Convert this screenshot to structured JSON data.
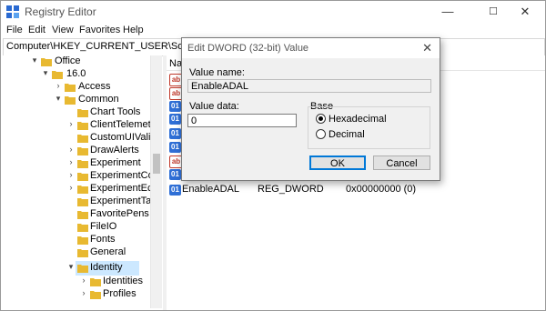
{
  "window": {
    "title": "Registry Editor",
    "minimize": "—",
    "maximize": "☐",
    "close": "✕"
  },
  "menu": [
    "File",
    "Edit",
    "View",
    "Favorites",
    "Help"
  ],
  "address": "Computer\\HKEY_CURRENT_USER\\Software\\Micro",
  "tree": [
    {
      "label": "Office",
      "chev": "▾"
    },
    {
      "label": "16.0",
      "chev": "▾"
    },
    {
      "label": "Access",
      "chev": "›"
    },
    {
      "label": "Common",
      "chev": "▾"
    },
    {
      "label": "Chart Tools",
      "chev": ""
    },
    {
      "label": "ClientTelemetry",
      "chev": "›"
    },
    {
      "label": "CustomUIValidat",
      "chev": ""
    },
    {
      "label": "DrawAlerts",
      "chev": "›"
    },
    {
      "label": "Experiment",
      "chev": "›"
    },
    {
      "label": "ExperimentConfi",
      "chev": "›"
    },
    {
      "label": "ExperimentEcs",
      "chev": "›"
    },
    {
      "label": "ExperimentTas",
      "chev": ""
    },
    {
      "label": "FavoritePens",
      "chev": ""
    },
    {
      "label": "FileIO",
      "chev": ""
    },
    {
      "label": "Fonts",
      "chev": ""
    },
    {
      "label": "General",
      "chev": ""
    },
    {
      "label": "Identity",
      "chev": "▾"
    },
    {
      "label": "Identities",
      "chev": "›"
    },
    {
      "label": "Profiles",
      "chev": "›"
    }
  ],
  "right_pane": {
    "column_name": "Na",
    "row": {
      "name": "EnableADAL",
      "type": "REG_DWORD",
      "data": "0x00000000 (0)"
    }
  },
  "dialog": {
    "title": "Edit DWORD (32-bit) Value",
    "close": "✕",
    "value_name_label": "Value name:",
    "value_name": "EnableADAL",
    "value_data_label": "Value data:",
    "value_data": "0",
    "base_label": "Base",
    "base_options": [
      "Hexadecimal",
      "Decimal"
    ],
    "base_selected": "Hexadecimal",
    "ok": "OK",
    "cancel": "Cancel"
  },
  "colors": {
    "selection": "#cce8ff",
    "folder": "#e8b931",
    "accent": "#0078d7"
  }
}
